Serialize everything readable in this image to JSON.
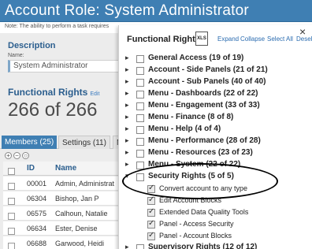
{
  "page": {
    "title": "Account Role: System Administrator",
    "note": "Note: The ability to perform a task requires"
  },
  "description": {
    "heading": "Description",
    "name_label": "Name:",
    "name_value": "System Administrator"
  },
  "functional_rights": {
    "heading": "Functional Rights",
    "edit_link": "Edit",
    "count": "266 of 266"
  },
  "tabs": [
    {
      "label": "Members (25)"
    },
    {
      "label": "Settings (11)"
    },
    {
      "label": "N"
    }
  ],
  "table": {
    "headers": [
      "ID",
      "Name"
    ],
    "rows": [
      {
        "id": "00001",
        "name": "Admin, Administrat"
      },
      {
        "id": "06304",
        "name": "Bishop, Jan P"
      },
      {
        "id": "06575",
        "name": "Calhoun, Natalie"
      },
      {
        "id": "06634",
        "name": "Ester, Denise"
      },
      {
        "id": "06688",
        "name": "Garwood, Heidi"
      }
    ]
  },
  "popup": {
    "title": "Functional Rights",
    "export_icon": "XLS",
    "links": [
      "Expand",
      "Collapse",
      "Select All",
      "Desele"
    ],
    "groups": [
      {
        "label": "General Access (19 of 19)"
      },
      {
        "label": "Account - Side Panels (21 of 21)"
      },
      {
        "label": "Account - Sub Panels (40 of 40)"
      },
      {
        "label": "Menu - Dashboards (22 of 22)"
      },
      {
        "label": "Menu - Engagement (33 of 33)"
      },
      {
        "label": "Menu - Finance (8 of 8)"
      },
      {
        "label": "Menu - Help (4 of 4)"
      },
      {
        "label": "Menu - Performance (28 of 28)"
      },
      {
        "label": "Menu - Resources (23 of 23)"
      },
      {
        "label": "Menu - System (22 of 22)"
      },
      {
        "label": "Security Rights (5 of 5)"
      }
    ],
    "security_items": [
      {
        "label": "Convert account to any type"
      },
      {
        "label": "Edit Account Blocks"
      },
      {
        "label": "Extended Data Quality Tools"
      },
      {
        "label": "Panel - Access Security"
      },
      {
        "label": "Panel - Account Blocks"
      }
    ],
    "last_group": {
      "label": "Supervisory Rights (12 of 12)"
    }
  },
  "colors": {
    "header_blue": "#3f7fb3",
    "heading_text": "#2b5e8e",
    "link_blue": "#2b6cb0"
  }
}
